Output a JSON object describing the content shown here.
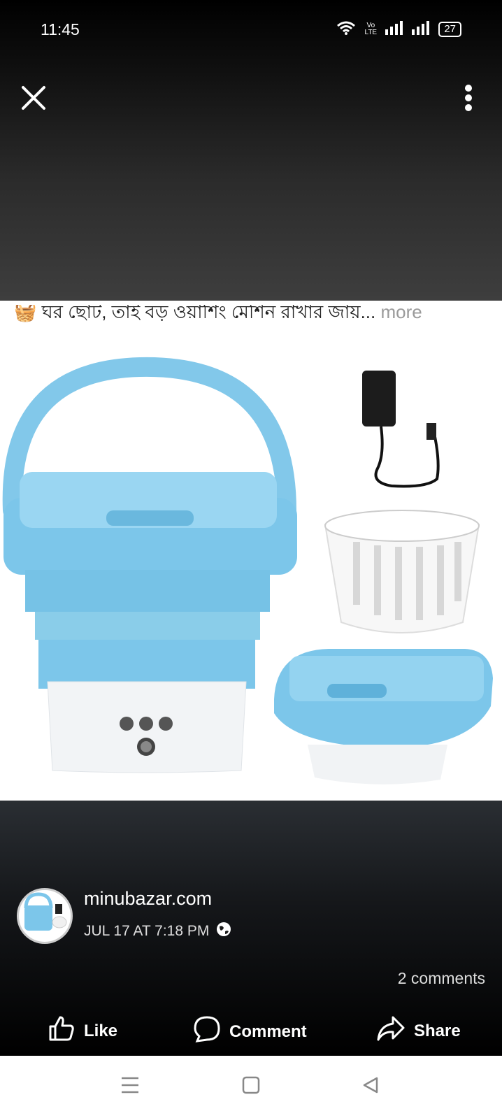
{
  "status_bar": {
    "time": "11:45",
    "network_label": "Vo LTE",
    "battery": "27"
  },
  "post": {
    "caption_text": "🧺 ঘর ছোট, তাই বড় ওয়াশিং মেশিন রাখার জায়...",
    "caption_more": "more",
    "page_name": "minubazar.com",
    "timestamp": "JUL 17 AT 7:18 PM",
    "comments_count": "2 comments"
  },
  "actions": {
    "like": "Like",
    "comment": "Comment",
    "share": "Share"
  },
  "icons": {
    "close": "close-icon",
    "more": "more-vertical-icon",
    "globe": "globe-icon",
    "like": "thumbs-up-icon",
    "comment": "comment-bubble-icon",
    "share": "share-arrow-icon"
  },
  "colors": {
    "overlay_dark": "#000000",
    "product_blue": "#7cc6ea",
    "product_white": "#f2f4f6"
  }
}
